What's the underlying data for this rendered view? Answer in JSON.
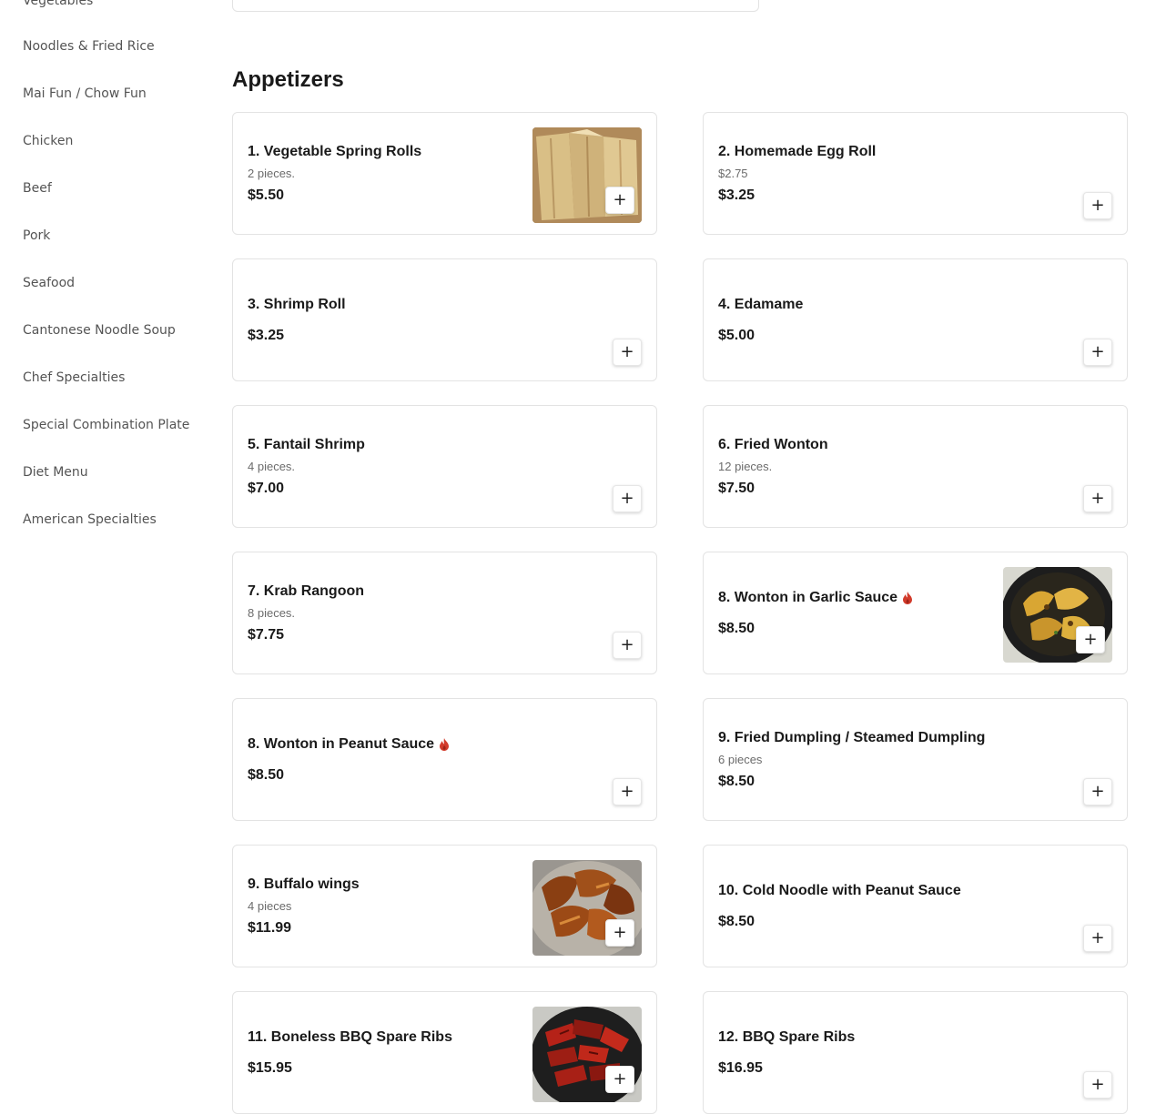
{
  "sidebar": {
    "items": [
      {
        "label": "Vegetables"
      },
      {
        "label": "Noodles & Fried Rice"
      },
      {
        "label": "Mai Fun / Chow Fun"
      },
      {
        "label": "Chicken"
      },
      {
        "label": "Beef"
      },
      {
        "label": "Pork"
      },
      {
        "label": "Seafood"
      },
      {
        "label": "Cantonese Noodle Soup"
      },
      {
        "label": "Chef Specialties"
      },
      {
        "label": "Special Combination Plate"
      },
      {
        "label": "Diet Menu"
      },
      {
        "label": "American Specialties"
      }
    ]
  },
  "section": {
    "title": "Appetizers"
  },
  "add_label": "+",
  "items": [
    {
      "name": "1. Vegetable Spring Rolls",
      "desc": "2 pieces.",
      "price": "$5.50",
      "image": "spring-rolls",
      "spicy": false
    },
    {
      "name": "2. Homemade Egg Roll",
      "desc": "$2.75",
      "price": "$3.25",
      "image": null,
      "spicy": false
    },
    {
      "name": "3. Shrimp Roll",
      "desc": "",
      "price": "$3.25",
      "image": null,
      "spicy": false
    },
    {
      "name": "4. Edamame",
      "desc": "",
      "price": "$5.00",
      "image": null,
      "spicy": false
    },
    {
      "name": "5. Fantail Shrimp",
      "desc": "4 pieces.",
      "price": "$7.00",
      "image": null,
      "spicy": false
    },
    {
      "name": "6. Fried Wonton",
      "desc": "12 pieces.",
      "price": "$7.50",
      "image": null,
      "spicy": false
    },
    {
      "name": "7. Krab Rangoon",
      "desc": "8 pieces.",
      "price": "$7.75",
      "image": null,
      "spicy": false
    },
    {
      "name": "8. Wonton in Garlic Sauce",
      "desc": "",
      "price": "$8.50",
      "image": "garlic-wontons",
      "spicy": true
    },
    {
      "name": "8. Wonton in Peanut Sauce",
      "desc": "",
      "price": "$8.50",
      "image": null,
      "spicy": true
    },
    {
      "name": "9. Fried Dumpling / Steamed Dumpling",
      "desc": "6 pieces",
      "price": "$8.50",
      "image": null,
      "spicy": false
    },
    {
      "name": "9. Buffalo wings",
      "desc": "4 pieces",
      "price": "$11.99",
      "image": "buffalo-wings",
      "spicy": false
    },
    {
      "name": "10. Cold Noodle with Peanut Sauce",
      "desc": "",
      "price": "$8.50",
      "image": null,
      "spicy": false
    },
    {
      "name": "11. Boneless BBQ Spare Ribs",
      "desc": "",
      "price": "$15.95",
      "image": "bbq-ribs",
      "spicy": false
    },
    {
      "name": "12. BBQ Spare Ribs",
      "desc": "",
      "price": "$16.95",
      "image": null,
      "spicy": false
    }
  ],
  "colors": {
    "spicy": "#d23b2b",
    "border": "#e3e3e3",
    "muted": "#6b6b6b"
  }
}
